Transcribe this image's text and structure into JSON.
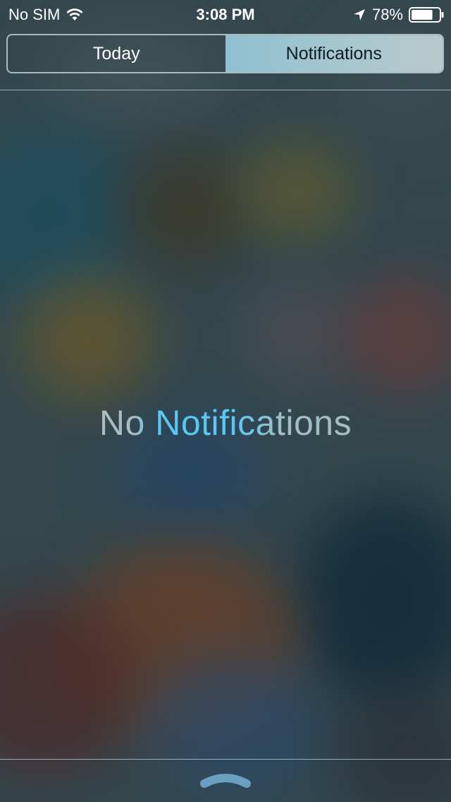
{
  "status_bar": {
    "carrier": "No SIM",
    "wifi_icon": "wifi-icon",
    "time": "3:08 PM",
    "location_icon": "location-arrow-icon",
    "battery_percent": "78%",
    "battery_level": 0.78,
    "battery_icon": "battery-icon"
  },
  "segmented_control": {
    "tabs": [
      {
        "label": "Today",
        "selected": false
      },
      {
        "label": "Notifications",
        "selected": true
      }
    ]
  },
  "main": {
    "empty_message": "No Notifications"
  },
  "bottom": {
    "grabber_icon": "chevron-up-grabber-icon"
  },
  "colors": {
    "accent": "#5ac8f2",
    "selected_tab_bg": "#a9c7cf"
  }
}
